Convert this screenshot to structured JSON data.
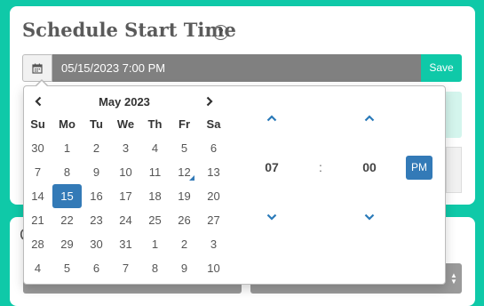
{
  "page": {
    "title": "Schedule Start Time",
    "help_glyph": "?",
    "date_value": "05/15/2023 7:00 PM",
    "save_label": "Save",
    "lower_section_initial": "C"
  },
  "datepicker": {
    "month_label": "May 2023",
    "weekdays": [
      "Su",
      "Mo",
      "Tu",
      "We",
      "Th",
      "Fr",
      "Sa"
    ],
    "weeks": [
      [
        "30",
        "1",
        "2",
        "3",
        "4",
        "5",
        "6"
      ],
      [
        "7",
        "8",
        "9",
        "10",
        "11",
        "12",
        "13"
      ],
      [
        "14",
        "15",
        "16",
        "17",
        "18",
        "19",
        "20"
      ],
      [
        "21",
        "22",
        "23",
        "24",
        "25",
        "26",
        "27"
      ],
      [
        "28",
        "29",
        "30",
        "31",
        "1",
        "2",
        "3"
      ],
      [
        "4",
        "5",
        "6",
        "7",
        "8",
        "9",
        "10"
      ]
    ],
    "selected_day": "15",
    "today_day": "12"
  },
  "timepicker": {
    "hour": "07",
    "separator": ":",
    "minute": "00",
    "period": "PM"
  },
  "colors": {
    "accent": "#0fc9a8",
    "selected": "#337ab7",
    "input_bg": "#808080"
  },
  "icons": [
    "calendar-icon",
    "chevron-left-icon",
    "chevron-right-icon",
    "chevron-up-icon",
    "chevron-down-icon",
    "help-icon"
  ]
}
